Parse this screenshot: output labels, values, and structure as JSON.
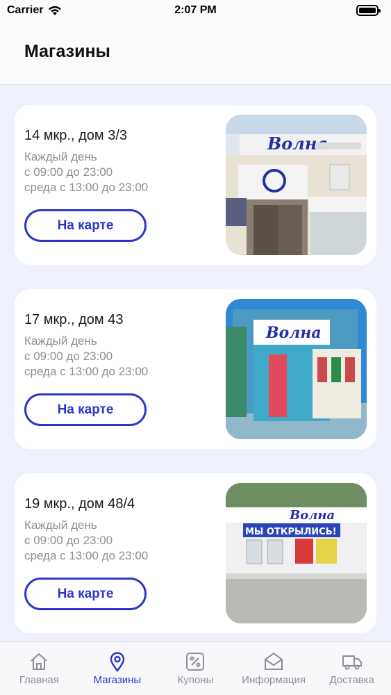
{
  "status_bar": {
    "carrier": "Carrier",
    "time": "2:07 PM"
  },
  "header": {
    "title": "Магазины"
  },
  "stores": [
    {
      "address": "14 мкр., дом 3/3",
      "hours": [
        "Каждый день",
        "с 09:00 до 23:00",
        "среда с 13:00 до 23:00"
      ],
      "map_button": "На карте",
      "photo_sign": "Волна"
    },
    {
      "address": "17 мкр., дом 43",
      "hours": [
        "Каждый день",
        "с 09:00 до 23:00",
        "среда с 13:00 до 23:00"
      ],
      "map_button": "На карте",
      "photo_sign": "Волна"
    },
    {
      "address": "19 мкр., дом 48/4",
      "hours": [
        "Каждый день",
        "с 09:00 до 23:00",
        "среда с 13:00 до 23:00"
      ],
      "map_button": "На карте",
      "photo_sign": "Волна",
      "photo_banner": "МЫ ОТКРЫЛИСЬ!"
    }
  ],
  "tab_bar": {
    "tabs": [
      {
        "label": "Главная",
        "icon": "home-icon"
      },
      {
        "label": "Магазины",
        "icon": "location-pin-icon",
        "active": true
      },
      {
        "label": "Купоны",
        "icon": "coupon-icon"
      },
      {
        "label": "Информация",
        "icon": "envelope-icon"
      },
      {
        "label": "Доставка",
        "icon": "truck-icon"
      }
    ]
  },
  "colors": {
    "accent": "#2b37c9",
    "background": "#eef0fb",
    "card": "#ffffff",
    "muted_text": "#8e8e93"
  }
}
